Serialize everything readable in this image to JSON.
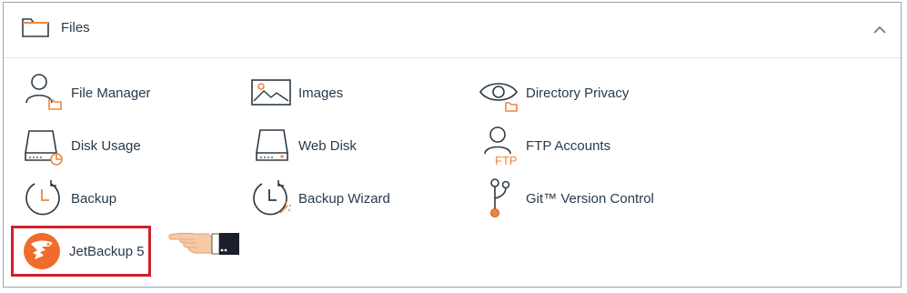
{
  "section": {
    "title": "Files",
    "collapse_icon": "chevron-up-icon"
  },
  "apps": [
    {
      "label": "File Manager",
      "icon": "file-manager-icon"
    },
    {
      "label": "Images",
      "icon": "images-icon"
    },
    {
      "label": "Directory Privacy",
      "icon": "directory-privacy-icon"
    },
    {
      "label": "Disk Usage",
      "icon": "disk-usage-icon"
    },
    {
      "label": "Web Disk",
      "icon": "web-disk-icon"
    },
    {
      "label": "FTP Accounts",
      "icon": "ftp-accounts-icon"
    },
    {
      "label": "Backup",
      "icon": "backup-icon"
    },
    {
      "label": "Backup Wizard",
      "icon": "backup-wizard-icon"
    },
    {
      "label": "Git™ Version Control",
      "icon": "git-icon"
    },
    {
      "label": "JetBackup 5",
      "icon": "jetbackup-logo-icon"
    }
  ],
  "ftp_icon_text": "FTP",
  "colors": {
    "accent": "#f0853e",
    "text": "#293a4a",
    "icon_stroke": "#2d3a45",
    "highlight": "#d0202a"
  }
}
